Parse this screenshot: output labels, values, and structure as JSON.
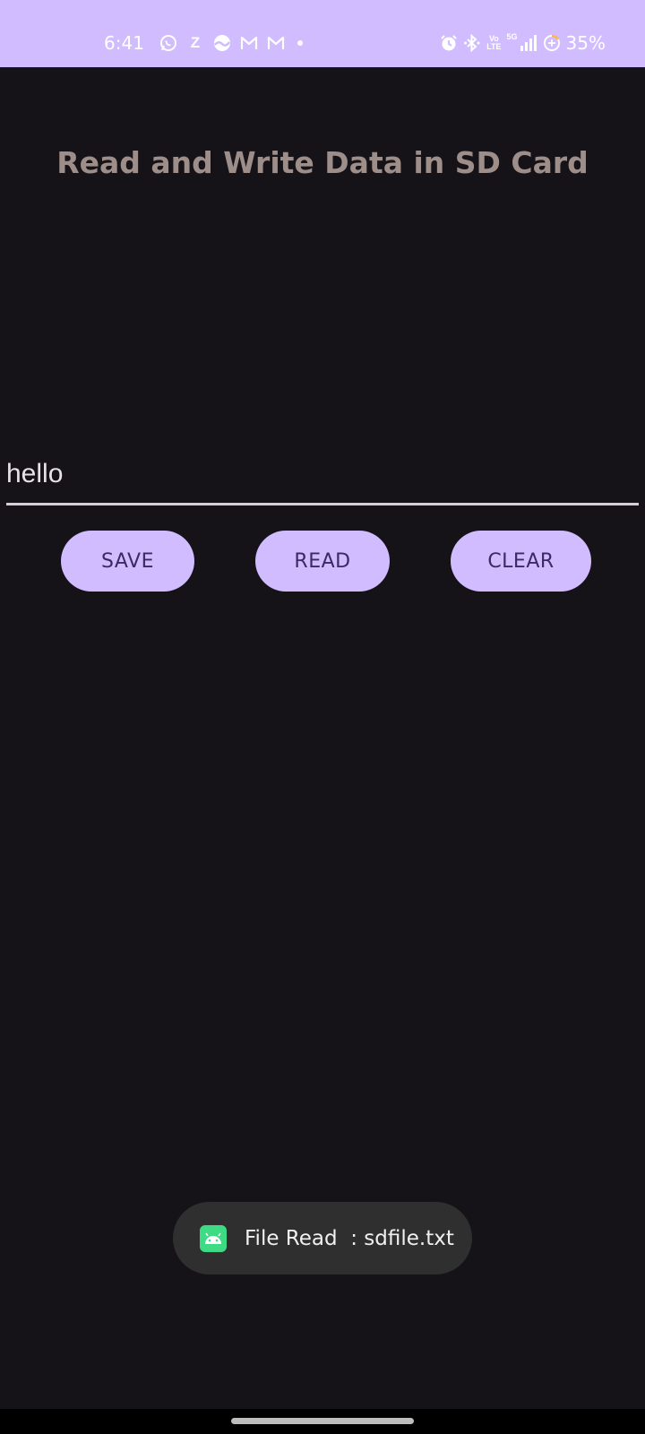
{
  "status_bar": {
    "time": "6:41",
    "notif_z": "Z",
    "network_volte_top": "Vo",
    "network_volte_bottom": "LTE",
    "network_5g": "5G",
    "battery_percent": "35%",
    "background_color": "#d0bcff",
    "notification_icons": [
      "whatsapp-icon",
      "z-icon",
      "weather-icon",
      "gmail-icon",
      "gmail-icon",
      "more-dot-icon"
    ],
    "system_icons": [
      "alarm-icon",
      "bluetooth-icon",
      "volte-icon",
      "signal-icon",
      "battery-saver-icon"
    ]
  },
  "app": {
    "title": "Read and Write Data in SD Card",
    "input": {
      "value": "hello",
      "placeholder": ""
    },
    "buttons": {
      "save_label": "SAVE",
      "read_label": "READ",
      "clear_label": "CLEAR"
    },
    "accent_color": "#d0bcff",
    "background_color": "#151218"
  },
  "toast": {
    "message": "File Read  : sdfile.txt",
    "icon": "android-icon"
  }
}
